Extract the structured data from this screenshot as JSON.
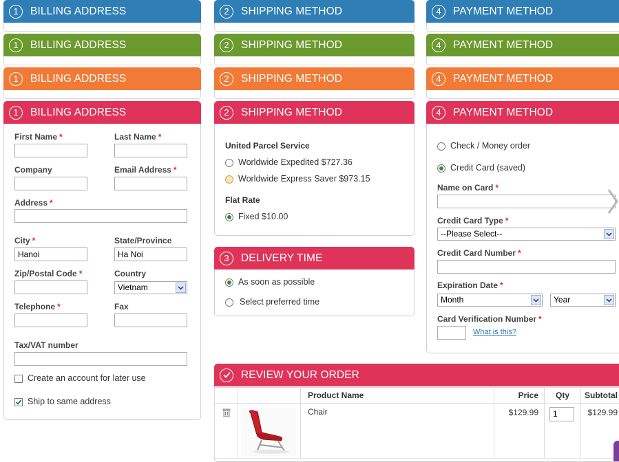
{
  "billing": {
    "num": "1",
    "title": "BILLING ADDRESS"
  },
  "shipping": {
    "num": "2",
    "title": "SHIPPING METHOD"
  },
  "payment": {
    "num": "4",
    "title": "PAYMENT METHOD"
  },
  "delivery": {
    "num": "3",
    "title": "DELIVERY TIME"
  },
  "review": {
    "title": "REVIEW YOUR ORDER"
  },
  "colors": {
    "blue": "#2f7fb6",
    "green": "#6b9a2e",
    "orange": "#f07a36",
    "red": "#e0335a"
  },
  "billing_form": {
    "first_name": "First Name",
    "last_name": "Last Name",
    "company": "Company",
    "email": "Email Address",
    "address": "Address",
    "city": "City",
    "city_value": "Hanoi",
    "state": "State/Province",
    "state_value": "Ha Noi",
    "zip": "Zip/Postal Code",
    "country": "Country",
    "country_value": "Vietnam",
    "telephone": "Telephone",
    "fax": "Fax",
    "tax": "Tax/VAT number",
    "create_account": "Create an account for later use",
    "ship_same": "Ship to same address",
    "required_mark": "*"
  },
  "shipping_methods": {
    "ups_title": "United Parcel Service",
    "ups_options": [
      {
        "label": "Worldwide Expedited $727.36"
      },
      {
        "label": "Worldwide Express Saver $973.15"
      }
    ],
    "flat_title": "Flat Rate",
    "flat_option": "Fixed $10.00"
  },
  "delivery_options": {
    "asap": "As soon as possible",
    "preferred": "Select preferred time"
  },
  "payment_form": {
    "check_money": "Check / Money order",
    "credit_saved": "Credit Card (saved)",
    "name_on_card": "Name on Card",
    "card_type": "Credit Card Type",
    "card_type_value": "--Please Select--",
    "card_number": "Credit Card Number",
    "expiration": "Expiration Date",
    "month_value": "Month",
    "year_value": "Year",
    "cvn": "Card Verification Number",
    "what_is_this": "What is this?"
  },
  "review_table": {
    "headers": {
      "product": "Product Name",
      "price": "Price",
      "qty": "Qty",
      "subtotal": "Subtotal"
    },
    "rows": [
      {
        "product": "Chair",
        "price": "$129.99",
        "qty": "1",
        "subtotal": "$129.99"
      }
    ]
  }
}
